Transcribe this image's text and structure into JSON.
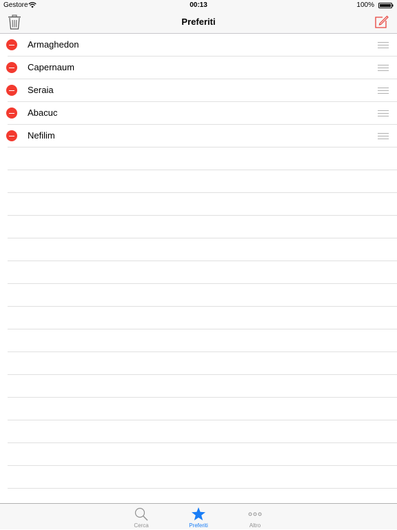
{
  "status_bar": {
    "carrier": "Gestore",
    "time": "00:13",
    "battery": "100%"
  },
  "nav": {
    "title": "Preferiti",
    "left_icon": "trash-icon",
    "right_icon": "compose-icon"
  },
  "favorites": [
    {
      "label": "Armaghedon"
    },
    {
      "label": "Capernaum"
    },
    {
      "label": "Seraia"
    },
    {
      "label": "Abacuc"
    },
    {
      "label": "Nefilim"
    }
  ],
  "tabs": [
    {
      "label": "Cerca",
      "icon": "search-icon",
      "active": false
    },
    {
      "label": "Preferiti",
      "icon": "star-icon",
      "active": true
    },
    {
      "label": "Altro",
      "icon": "more-icon",
      "active": false
    }
  ],
  "colors": {
    "accent": "#1a7ef6",
    "destructive": "#f33a2f",
    "nav_icon": "#e8413b"
  }
}
